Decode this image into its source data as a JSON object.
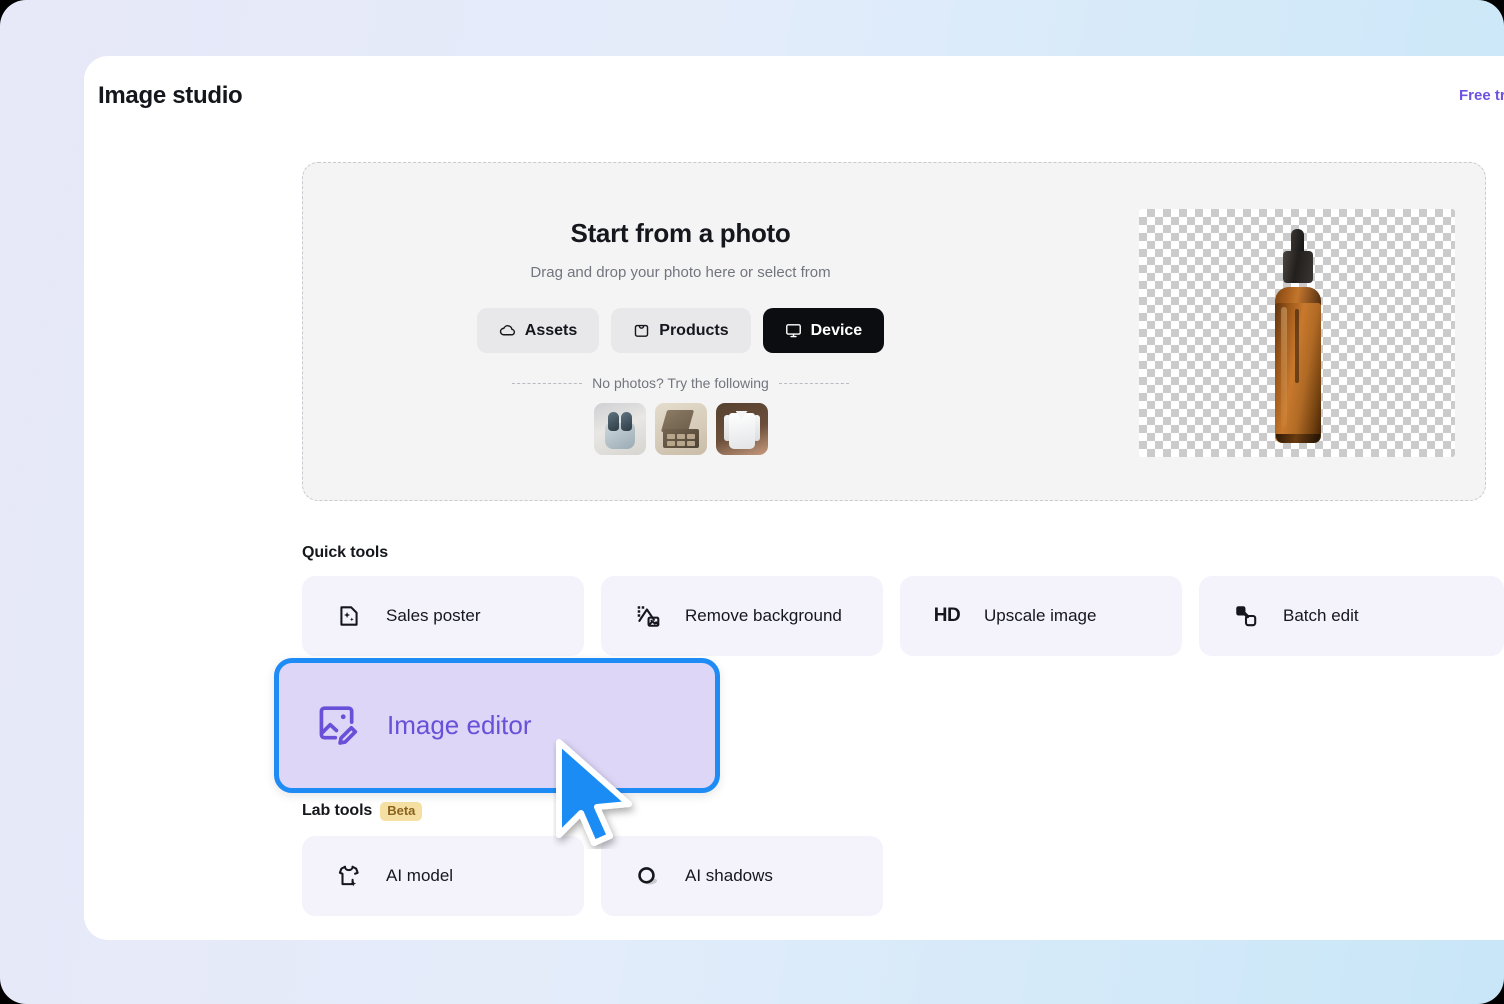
{
  "header": {
    "title": "Image studio",
    "free_trial_label": "Free tr"
  },
  "dropzone": {
    "title": "Start from a photo",
    "subtitle": "Drag and drop your photo here or select from",
    "divider_text": "No photos? Try the following",
    "sources": [
      {
        "label": "Assets",
        "icon": "cloud-icon",
        "active": false
      },
      {
        "label": "Products",
        "icon": "bag-icon",
        "active": false
      },
      {
        "label": "Device",
        "icon": "monitor-icon",
        "active": true
      }
    ],
    "sample_thumbnails": [
      {
        "name": "earbuds-thumbnail"
      },
      {
        "name": "makeup-palette-thumbnail"
      },
      {
        "name": "white-shirt-thumbnail"
      }
    ],
    "preview": {
      "name": "amber-dropper-bottle-preview",
      "background": "transparency-checkerboard"
    }
  },
  "quick_tools": {
    "heading": "Quick tools",
    "cards": [
      {
        "label": "Sales poster",
        "icon": "sparkle-document-icon"
      },
      {
        "label": "Remove background",
        "icon": "remove-background-icon"
      },
      {
        "label": "Upscale image",
        "icon": "hd-icon"
      },
      {
        "label": "Batch edit",
        "icon": "batch-layers-icon"
      }
    ],
    "highlighted_card": {
      "label": "Image editor",
      "icon": "image-edit-icon",
      "selected": true
    }
  },
  "lab_tools": {
    "heading": "Lab tools",
    "badge": "Beta",
    "cards": [
      {
        "label": "AI model",
        "icon": "tshirt-sparkle-icon"
      },
      {
        "label": "AI shadows",
        "icon": "shadow-circle-icon"
      }
    ]
  },
  "cursor": {
    "name": "mouse-pointer",
    "color": "#1f8cf5"
  },
  "colors": {
    "accent_purple": "#6a4fd8",
    "highlight_blue": "#1f8cf5",
    "highlight_fill": "#ddd6f7",
    "card_bg": "#f4f3fc",
    "beta_badge_bg": "#f5dfa2",
    "beta_badge_text": "#8a6320",
    "page_bg_start": "#e7e8f8",
    "page_bg_end": "#c8e6f8"
  }
}
